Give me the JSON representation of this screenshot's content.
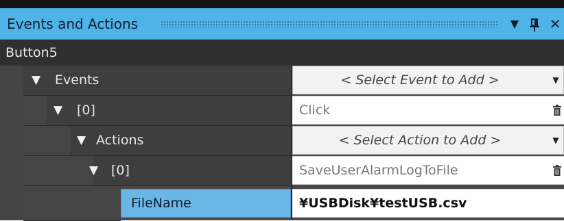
{
  "panel": {
    "title": "Events and Actions",
    "dropdown_icon": "caret-down-icon",
    "pin_icon": "pin-icon",
    "close_icon": "close-icon"
  },
  "object_name": "Button5",
  "rows": [
    {
      "label": "Events",
      "value": "< Select Event to Add >"
    },
    {
      "label": "[0]",
      "value": "Click"
    },
    {
      "label": "Actions",
      "value": "< Select Action to Add >"
    },
    {
      "label": "[0]",
      "value": "SaveUserAlarmLogToFile"
    },
    {
      "label": "FileName",
      "value": "¥USBDisk¥testUSB.csv"
    }
  ],
  "glyphs": {
    "expanded": "▼",
    "dropdown": "▼",
    "pin": "ꟼ",
    "close": "✕"
  },
  "colors": {
    "title_bar": "#4fb3e8",
    "selected_row": "#6ab6e6",
    "grid_background": "#3e3e3e"
  }
}
